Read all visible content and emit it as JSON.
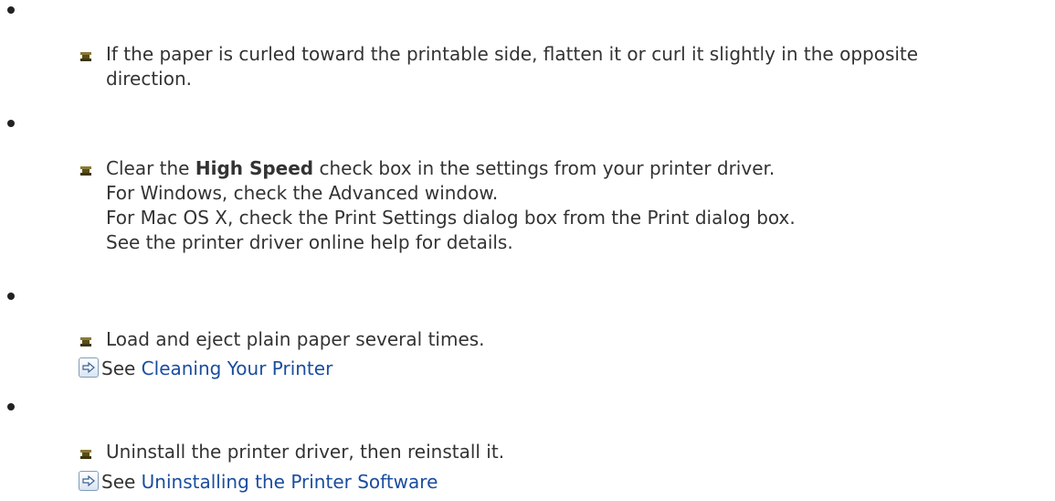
{
  "items": [
    {
      "lines": [
        "If the paper is curled toward the printable side, flatten it or curl it slightly in the opposite",
        "direction."
      ]
    },
    {
      "pre": "Clear the ",
      "bold": "High Speed",
      "post": " check box in the settings from your printer driver.",
      "lines": [
        "For Windows, check the Advanced window.",
        "For Mac OS X, check the Print Settings dialog box from the Print dialog box.",
        "See the printer driver online help for details."
      ]
    },
    {
      "lines": [
        "Load and eject plain paper several times."
      ],
      "see_label": "See",
      "see_link": "Cleaning Your Printer"
    },
    {
      "lines": [
        "Uninstall the printer driver, then reinstall it."
      ],
      "see_label": "See",
      "see_link": "Uninstalling the Printer Software"
    }
  ],
  "icons": {
    "bullet": "bullet-dot-icon",
    "item_marker": "square-bullet-icon",
    "see_arrow": "arrow-right-icon"
  },
  "colors": {
    "text": "#333333",
    "link": "#1a4d9e"
  }
}
